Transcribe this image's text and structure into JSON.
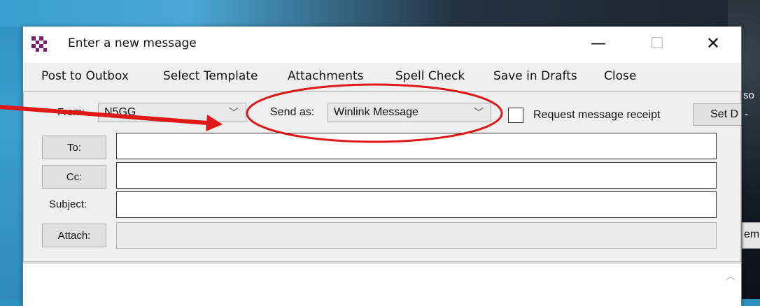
{
  "window": {
    "title": "Enter a new message",
    "controls": {
      "minimize": "—",
      "maximize": "☐",
      "close": "✕"
    }
  },
  "menu": {
    "items": [
      "Post to Outbox",
      "Select Template",
      "Attachments",
      "Spell Check",
      "Save in Drafts",
      "Close"
    ]
  },
  "form": {
    "from_label": "From:",
    "from_value": "N5GG",
    "send_as_label": "Send as:",
    "send_as_value": "Winlink Message",
    "receipt_label": "Request message receipt",
    "receipt_checked": false,
    "set_date_label": "Set D",
    "to_button": "To:",
    "cc_button": "Cc:",
    "subject_label": "Subject:",
    "attach_button": "Attach:",
    "to_value": "",
    "cc_value": "",
    "subject_value": "",
    "attach_value": ""
  },
  "background": {
    "snippet_so": "so",
    "snippet_em": "em",
    "snippet_dash": "-"
  },
  "colors": {
    "annotation_red": "#e01818",
    "icon_purple": "#7a1f6e"
  },
  "icons": {
    "app": "checkered-app-icon",
    "chevron": "chevron-down-icon",
    "scroll_up": "scroll-up-arrow-icon"
  }
}
